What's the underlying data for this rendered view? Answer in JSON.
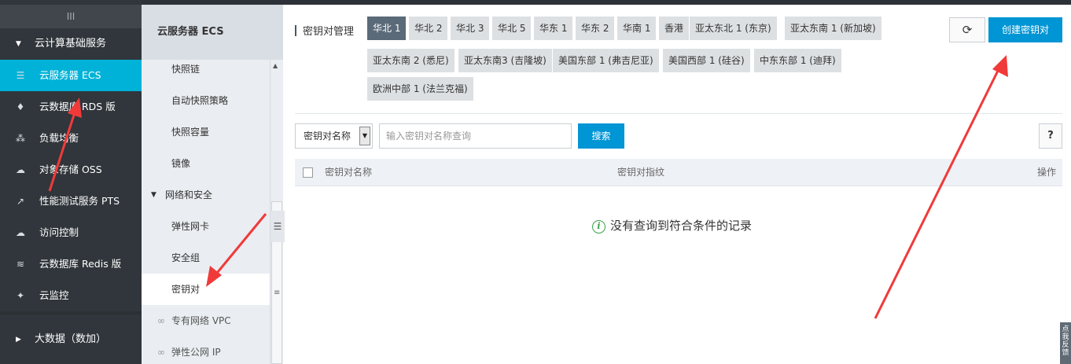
{
  "left_nav": {
    "grip_glyph": "III",
    "group_top": "云计算基础服务",
    "items": [
      {
        "icon": "server-icon",
        "glyph": "☰",
        "label": "云服务器 ECS",
        "active": true
      },
      {
        "icon": "database-icon",
        "glyph": "♦",
        "label": "云数据库 RDS 版",
        "active": false
      },
      {
        "icon": "load-balancer-icon",
        "glyph": "⁂",
        "label": "负载均衡",
        "active": false
      },
      {
        "icon": "cloud-upload-icon",
        "glyph": "☁",
        "label": "对象存储 OSS",
        "active": false
      },
      {
        "icon": "performance-chart-icon",
        "glyph": "↗",
        "label": "性能测试服务 PTS",
        "active": false
      },
      {
        "icon": "access-control-icon",
        "glyph": "☁",
        "label": "访问控制",
        "active": false
      },
      {
        "icon": "redis-icon",
        "glyph": "≋",
        "label": "云数据库 Redis 版",
        "active": false
      },
      {
        "icon": "monitor-icon",
        "glyph": "✦",
        "label": "云监控",
        "active": false
      }
    ],
    "group_bottom": "大数据（数加）"
  },
  "sub_nav": {
    "header": "云服务器 ECS",
    "items": [
      {
        "type": "item",
        "label": "快照链"
      },
      {
        "type": "item",
        "label": "自动快照策略"
      },
      {
        "type": "item",
        "label": "快照容量"
      },
      {
        "type": "item",
        "label": "镜像"
      },
      {
        "type": "group",
        "label": "网络和安全"
      },
      {
        "type": "item",
        "label": "弹性网卡"
      },
      {
        "type": "item",
        "label": "安全组"
      },
      {
        "type": "item",
        "label": "密钥对",
        "active": true
      },
      {
        "type": "link",
        "label": "专有网络 VPC"
      },
      {
        "type": "link",
        "label": "弹性公网 IP"
      }
    ]
  },
  "main": {
    "title": "密钥对管理",
    "regions": [
      {
        "label": "华北 1",
        "active": true
      },
      {
        "label": "华北 2"
      },
      {
        "label": "华北 3"
      },
      {
        "label": "华北 5"
      },
      {
        "label": "华东 1"
      },
      {
        "label": "华东 2"
      },
      {
        "label": "华南 1"
      },
      {
        "label": "香港"
      },
      {
        "label": "亚太东北 1 (东京)"
      },
      {
        "label": "亚太东南 1 (新加坡)"
      },
      {
        "label": "亚太东南 2 (悉尼)"
      },
      {
        "label": "亚太东南3 (吉隆坡)"
      },
      {
        "label": "美国东部 1 (弗吉尼亚)"
      },
      {
        "label": "美国西部 1 (硅谷)"
      },
      {
        "label": "中东东部 1 (迪拜)"
      },
      {
        "label": "欧洲中部 1 (法兰克福)"
      }
    ],
    "refresh_glyph": "⟳",
    "create_button": "创建密钥对",
    "search_select_value": "密钥对名称",
    "search_placeholder": "输入密钥对名称查询",
    "search_button": "搜索",
    "help_button": "?",
    "table_headers": [
      "密钥对名称",
      "密钥对指纹",
      "操作"
    ],
    "empty_message": "没有查询到符合条件的记录"
  },
  "feedback_tab": "点我反馈",
  "colors": {
    "nav_bg": "#30363b",
    "nav_active": "#00b2d8",
    "region_active": "#5a6a79",
    "primary_button": "#0095d4",
    "annotation_arrow": "#f03a3a"
  }
}
